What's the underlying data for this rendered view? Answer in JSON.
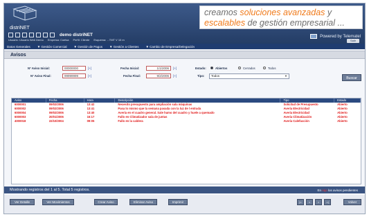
{
  "header": {
    "logo_text": "distriNET",
    "tagline_line1_prefix": "creamos ",
    "tagline_line1_highlight": "soluciones avanzadas",
    "tagline_line1_suffix": " y",
    "tagline_line2_highlight": "escalables",
    "tagline_line2_suffix": " de gestión empresarial ...",
    "demo_label": "demo distriNET",
    "top_links": [
      "Usuario: Usuario Web Demo",
      "Empresa: Coelsa",
      "Perfil: Cliente",
      "Esquema: ...TMT V 10 m"
    ],
    "powered_by": "Powered by Telematel",
    "logout_label": "Salir"
  },
  "nav": {
    "items": [
      "Datos Generales",
      "▼ Gestión Comercial",
      "▼ Gestión de Pagos",
      "▼ Gestión a Clientes",
      "▼ Cambio de Empresa/Delegación"
    ]
  },
  "section": {
    "title": "Avisos"
  },
  "filters": {
    "aviso_inicial_label": "Nº Aviso Inicial:",
    "aviso_inicial_value": "00000000",
    "aviso_final_label": "Nº Aviso Final:",
    "aviso_final_value": "99999999",
    "fecha_inicial_label": "Fecha Inicial:",
    "fecha_inicial_value": "1/1/2006",
    "fecha_final_label": "Fecha Final:",
    "fecha_final_value": "9/2/2006",
    "lookup_label": "[+]",
    "estados_label": "Estado:",
    "estado_options": [
      "Abiertos",
      "Cerrados",
      "Todos"
    ],
    "estado_selected": "Abiertos",
    "tipo_label": "Tipo:",
    "tipo_value": "Todos",
    "search_button": "Buscar"
  },
  "grid": {
    "columns": [
      "Aviso",
      "Fecha",
      "Hora",
      "Descripción",
      "Tipo",
      "Estado"
    ],
    "rows": [
      [
        "6000001",
        "09/02/2006",
        "13:42",
        "Necesito presupuesto para ampliación sala máquinas",
        "Solicitud de Presupuesto",
        "Abierto"
      ],
      [
        "6000002",
        "09/02/2006",
        "13:41",
        "Pasa lo mismo que la semana pasada con la luz de l entrada",
        "Avería Electricidad",
        "Abierto"
      ],
      [
        "6000004",
        "09/02/2006",
        "13:40",
        "Avería en el cuadro general. Sale humo del cuadro y huele a quemado",
        "Avería Electricidad",
        "Abierto"
      ],
      [
        "6000003",
        "20/01/2006",
        "16:17",
        "Fallo en Climatizador sala de juntas",
        "Avería Climatización",
        "Abierto"
      ],
      [
        "4000018",
        "22/10/2004",
        "09:05",
        "Fallo en la caldera",
        "Avería Calefacción",
        "Abierto"
      ]
    ]
  },
  "status": {
    "records_text": "Mostrando registros del 1 al 5. Total 5 registros.",
    "pending_prefix": "En ",
    "pending_highlight": "rojo",
    "pending_suffix": " los avisos pendientes"
  },
  "footer": {
    "buttons": [
      "Ver Detalle",
      "Ver Movimientos",
      "Crear Aviso",
      "Eliminar Aviso",
      "Imprimir"
    ],
    "pager": [
      "|<",
      "<",
      ">",
      ">|"
    ],
    "back_button": "Volver"
  }
}
